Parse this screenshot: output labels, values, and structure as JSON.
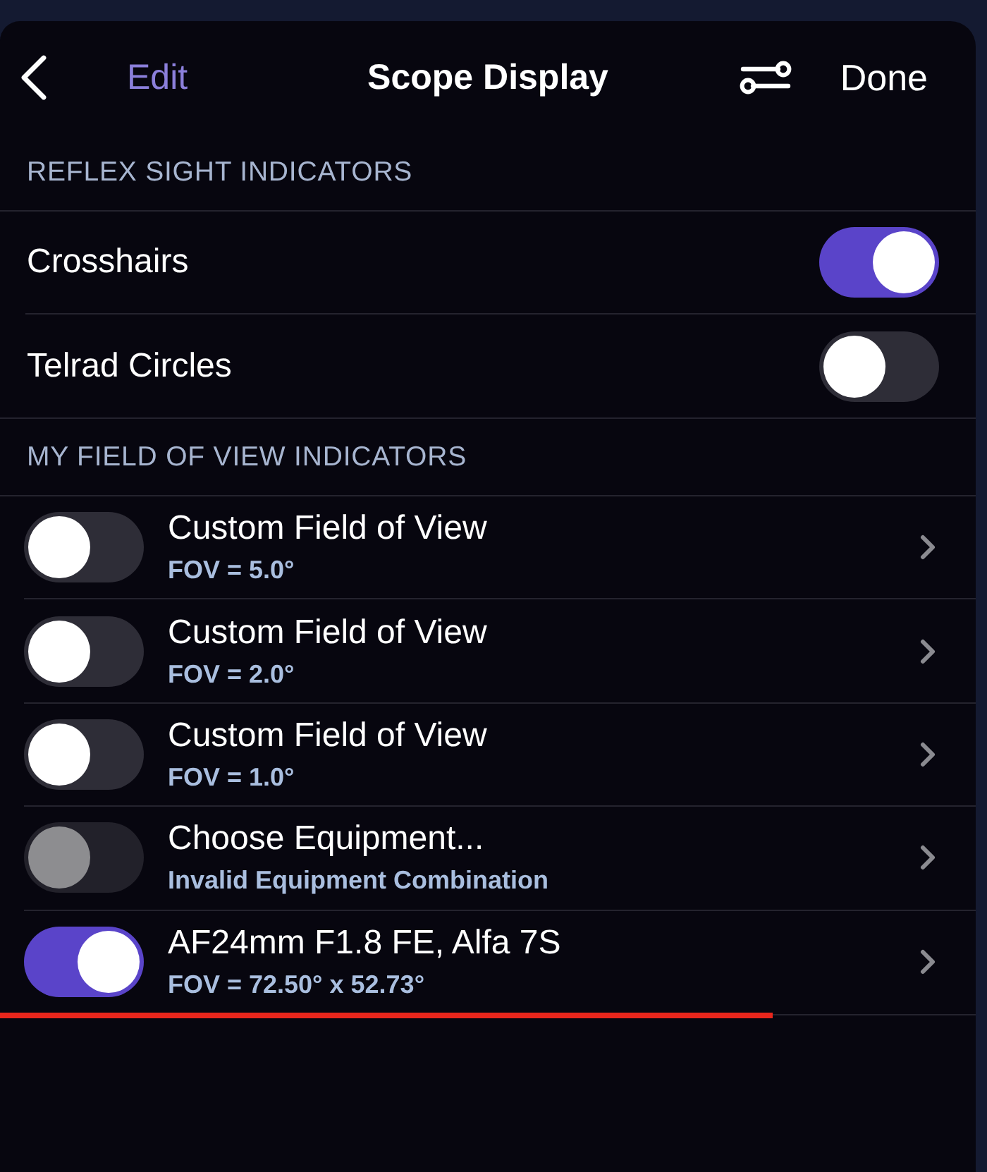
{
  "header": {
    "edit_label": "Edit",
    "title": "Scope Display",
    "done_label": "Done"
  },
  "sections": [
    {
      "title": "REFLEX SIGHT INDICATORS",
      "rows": [
        {
          "kind": "switch",
          "label": "Crosshairs",
          "on": true
        },
        {
          "kind": "switch",
          "label": "Telrad Circles",
          "on": false
        }
      ]
    },
    {
      "title": "MY FIELD OF VIEW INDICATORS",
      "rows": [
        {
          "kind": "detail",
          "title": "Custom Field of View",
          "subtitle": "FOV = 5.0°",
          "on": false,
          "disabled": false,
          "marked": false
        },
        {
          "kind": "detail",
          "title": "Custom Field of View",
          "subtitle": "FOV = 2.0°",
          "on": false,
          "disabled": false,
          "marked": false
        },
        {
          "kind": "detail",
          "title": "Custom Field of View",
          "subtitle": "FOV = 1.0°",
          "on": false,
          "disabled": false,
          "marked": false
        },
        {
          "kind": "detail",
          "title": "Choose Equipment...",
          "subtitle": "Invalid Equipment Combination",
          "on": false,
          "disabled": true,
          "marked": false
        },
        {
          "kind": "detail",
          "title": "AF24mm F1.8 FE, Alfa 7S",
          "subtitle": "FOV = 72.50° x 52.73°",
          "on": true,
          "disabled": false,
          "marked": true
        }
      ]
    }
  ]
}
